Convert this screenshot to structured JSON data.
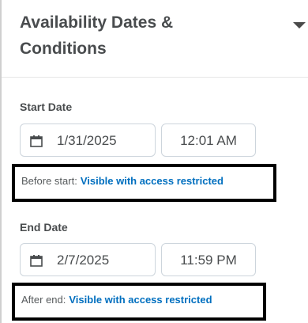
{
  "section": {
    "title": "Availability Dates & Conditions"
  },
  "start": {
    "label": "Start Date",
    "date": "1/31/2025",
    "time": "12:01 AM",
    "visibility_prefix": "Before start:",
    "visibility_value": "Visible with access restricted"
  },
  "end": {
    "label": "End Date",
    "date": "2/7/2025",
    "time": "11:59 PM",
    "visibility_prefix": "After end:",
    "visibility_value": "Visible with access restricted"
  },
  "icons": {
    "collapse": "caret-down-icon",
    "calendar": "calendar-icon"
  },
  "colors": {
    "text": "#494c4e",
    "link": "#006fbf",
    "highlight_border": "#000000"
  }
}
